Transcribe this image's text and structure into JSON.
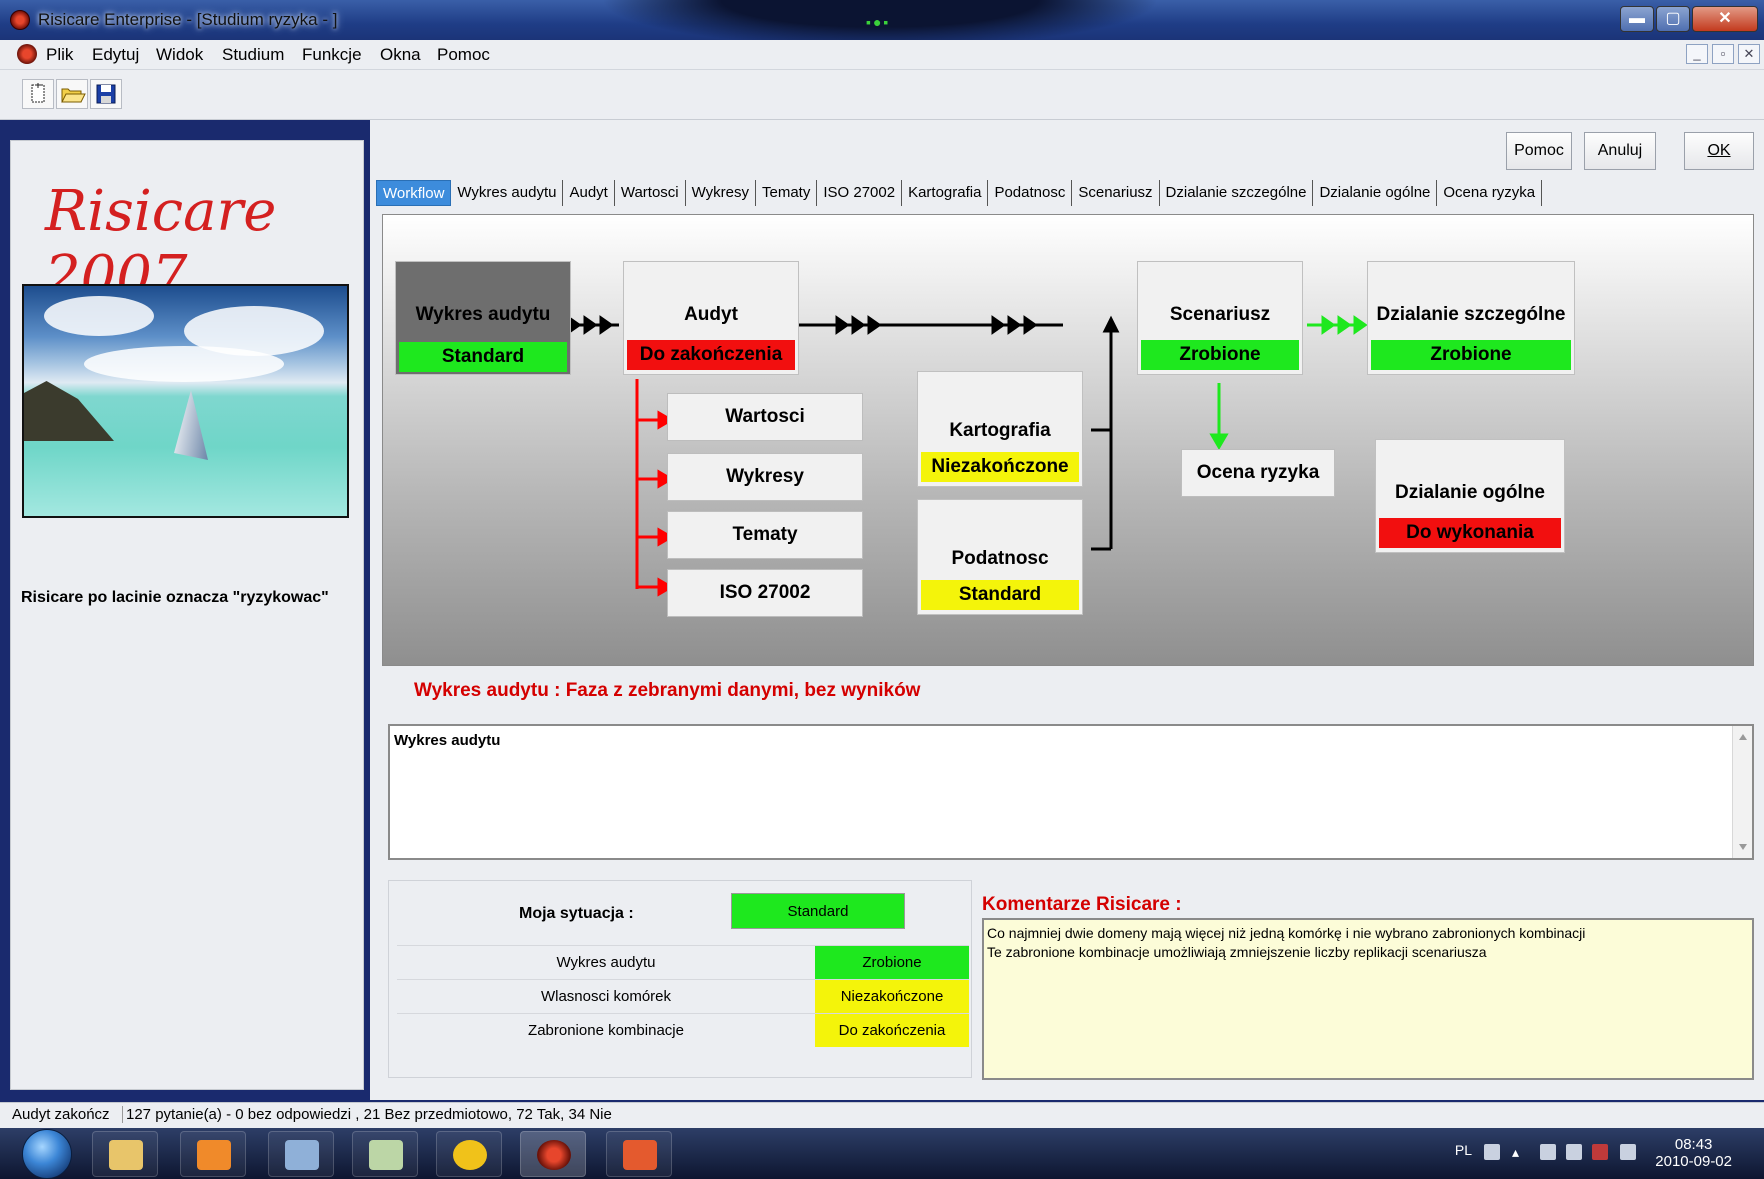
{
  "window": {
    "title": "Risicare Enterprise - [Studium ryzyka - ]",
    "minimize": "▬",
    "maximize": "▢",
    "close": "✕"
  },
  "menu": [
    "Plik",
    "Edytuj",
    "Widok",
    "Studium",
    "Funkcje",
    "Okna",
    "Pomoc"
  ],
  "mdi_controls": [
    "_",
    "▫",
    "✕"
  ],
  "left": {
    "brand": "Risicare 2007",
    "caption": "Risicare po lacinie oznacza \"ryzykowac\""
  },
  "buttons": {
    "help": "Pomoc",
    "cancel": "Anuluj",
    "ok": "OK"
  },
  "tabs": [
    "Workflow",
    "Wykres audytu",
    "Audyt",
    "Wartosci",
    "Wykresy",
    "Tematy",
    "ISO 27002",
    "Kartografia",
    "Podatnosc",
    "Scenariusz",
    "Dzialanie szczególne",
    "Dzialanie ogólne",
    "Ocena ryzyka"
  ],
  "active_tab": "Workflow",
  "workflow": {
    "wykres_audytu": {
      "label": "Wykres audytu",
      "status": "Standard"
    },
    "audyt": {
      "label": "Audyt",
      "status": "Do zakończenia"
    },
    "wartosci": "Wartosci",
    "wykresy": "Wykresy",
    "tematy": "Tematy",
    "iso": "ISO 27002",
    "kartografia": {
      "label": "Kartografia",
      "status": "Niezakończone"
    },
    "podatnosc": {
      "label": "Podatnosc",
      "status": "Standard"
    },
    "scenariusz": {
      "label": "Scenariusz",
      "status": "Zrobione"
    },
    "ocena": "Ocena ryzyka",
    "dz_szczegolne": {
      "label": "Dzialanie szczególne",
      "status": "Zrobione"
    },
    "dz_ogolne": {
      "label": "Dzialanie ogólne",
      "status": "Do wykonania"
    }
  },
  "phase_title": "Wykres audytu : Faza z zebranymi danymi, bez wyników",
  "description": "Wykres audytu",
  "situation": {
    "label": "Moja sytuacja :",
    "value": "Standard",
    "rows": [
      {
        "k": "Wykres audytu",
        "v": "Zrobione"
      },
      {
        "k": "Wlasnosci komórek",
        "v": "Niezakończone"
      },
      {
        "k": "Zabronione kombinacje",
        "v": "Do zakończenia"
      }
    ]
  },
  "comments": {
    "title": "Komentarze Risicare :",
    "line1": "Co najmniej dwie domeny mają więcej niż jedną komórkę i nie wybrano zabronionych kombinacji",
    "line2": "Te zabronione kombinacje umożliwiają zmniejszenie liczby replikacji scenariusza"
  },
  "status": {
    "left": "Audyt zakończ",
    "right": "127 pytanie(a) - 0 bez odpowiedzi , 21 Bez przedmiotowo, 72 Tak, 34 Nie"
  },
  "taskbar": {
    "lang": "PL",
    "time": "08:43",
    "date": "2010-09-02"
  },
  "colors": {
    "green": "#1ee81e",
    "red": "#f20f0f",
    "yellow": "#f4f40a",
    "tab_active": "#3d8cdc"
  }
}
